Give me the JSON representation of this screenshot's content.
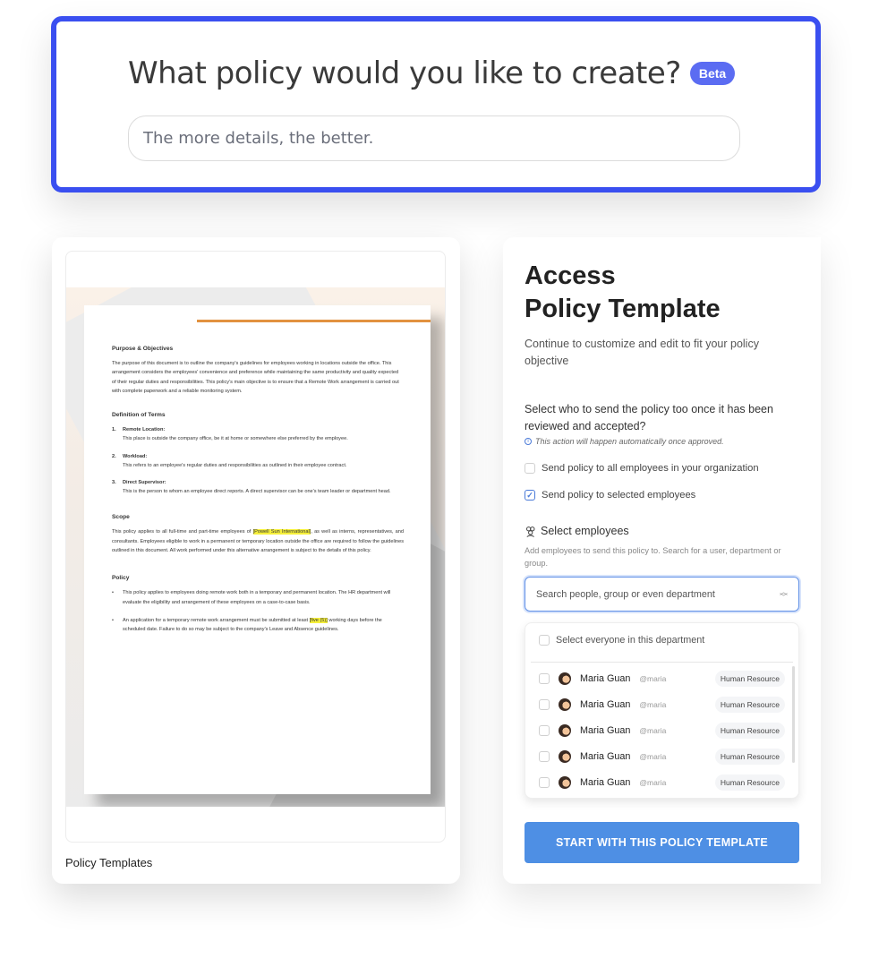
{
  "prompt": {
    "title": "What policy would you like to create?",
    "badge": "Beta",
    "input_placeholder": "The more details, the better.",
    "accent_color": "#3a4ff0"
  },
  "preview": {
    "caption": "Policy Templates",
    "document": {
      "purpose_heading": "Purpose & Objectives",
      "purpose_text": "The purpose of this document is to outline the company's guidelines for employees working in locations outside the office. This arrangement considers the employees' convenience and preference while maintaining the same productivity and quality expected of their regular duties and responsibilities. This policy's main objective is to ensure that a Remote Work arrangement is carried out with complete paperwork and a reliable monitoring system.",
      "definitions_heading": "Definition of Terms",
      "definitions": [
        {
          "num": "1.",
          "term": "Remote Location:",
          "text": "This place is outside the company office, be it at home or somewhere else preferred by the employee."
        },
        {
          "num": "2.",
          "term": "Workload:",
          "text": "This refers to an employee's regular duties and responsibilities as outlined in their employee contract."
        },
        {
          "num": "3.",
          "term": "Direct Supervisor:",
          "text": "This is the person to whom an employee direct reports. A direct supervisor can be one's team leader or department head."
        }
      ],
      "scope_heading": "Scope",
      "scope_before": "This policy applies to all full-time and part-time employees of ",
      "scope_highlight": "[Powell Sun International]",
      "scope_after": ", as well as interns, representatives, and consultants. Employees eligible to work in a permanent or temporary location outside the office are required to follow the guidelines outlined in this document. All work performed under this alternative arrangement is subject to the details of this policy.",
      "policy_heading": "Policy",
      "bullet1": "This policy applies to employees doing remote work both in a temporary and permanent location. The HR department will evaluate the eligibility and arrangement of these employees on a case-to-case basis.",
      "bullet2_before": "An application for a temporary remote work arrangement must be submitted at least ",
      "bullet2_highlight": "[five (5)]",
      "bullet2_after": " working days before the scheduled date. Failure to do so may be subject to the company's Leave and Absence guidelines."
    }
  },
  "access": {
    "title": "Access\nPolicy Template",
    "subtitle": "Continue to customize and edit to fit your policy objective",
    "question": "Select who to send the policy too once it has been reviewed and accepted?",
    "note": "This action will happen automatically once approved.",
    "options": [
      {
        "label": "Send policy to all employees in your organization",
        "checked": false
      },
      {
        "label": "Send policy to selected employees",
        "checked": true
      }
    ],
    "select_heading": "Select employees",
    "select_desc": "Add employees to send this policy to. Search for a user, department or group.",
    "search_placeholder": "Search people, group or even department",
    "select_all_label": "Select everyone in this department",
    "employees": [
      {
        "name": "Maria Guan",
        "handle": "@maria",
        "department": "Human Resource"
      },
      {
        "name": "Maria Guan",
        "handle": "@maria",
        "department": "Human Resource"
      },
      {
        "name": "Maria Guan",
        "handle": "@maria",
        "department": "Human Resource"
      },
      {
        "name": "Maria Guan",
        "handle": "@maria",
        "department": "Human Resource"
      },
      {
        "name": "Maria Guan",
        "handle": "@maria",
        "department": "Human Resource"
      }
    ],
    "button_label": "START WITH THIS POLICY TEMPLATE",
    "button_color": "#4e8fe4"
  }
}
